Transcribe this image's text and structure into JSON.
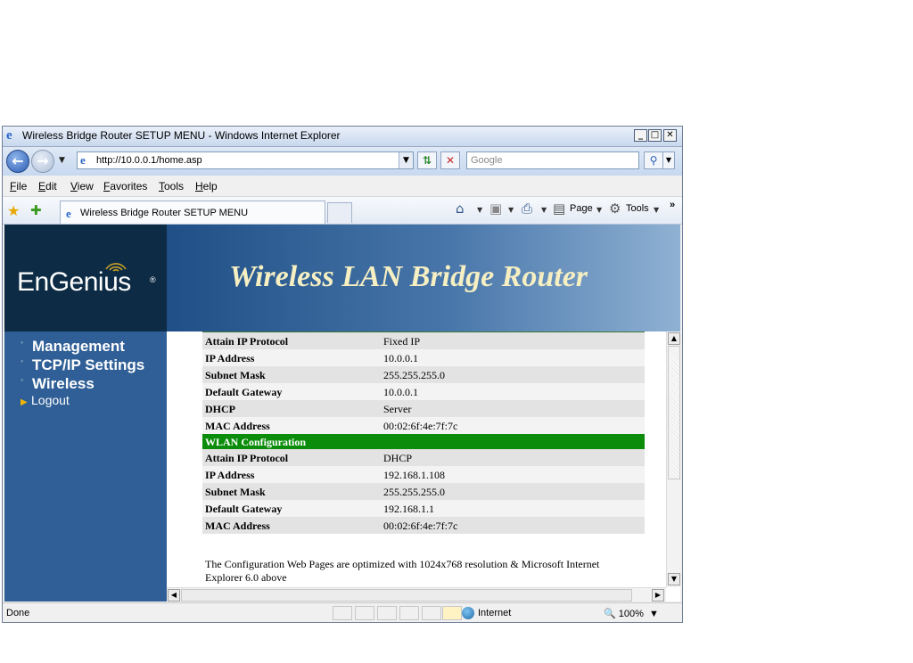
{
  "window": {
    "title": "Wireless Bridge Router SETUP MENU - Windows Internet Explorer",
    "minimize": "_",
    "maximize": "□",
    "close": "✕"
  },
  "address": {
    "url": "http://10.0.0.1/home.asp",
    "search_placeholder": "Google"
  },
  "menu": [
    "File",
    "Edit",
    "View",
    "Favorites",
    "Tools",
    "Help"
  ],
  "tab": {
    "label": "Wireless Bridge Router SETUP MENU"
  },
  "commands": {
    "page": "Page",
    "tools": "Tools"
  },
  "site": {
    "logo": "EnGenius",
    "logo_mark": "®",
    "banner_title": "Wireless LAN Bridge Router"
  },
  "sidebar": {
    "items": [
      "Management",
      "TCP/IP Settings",
      "Wireless"
    ],
    "logout": "Logout"
  },
  "lan": [
    {
      "key": "Attain IP Protocol",
      "value": "Fixed IP"
    },
    {
      "key": "IP Address",
      "value": "10.0.0.1"
    },
    {
      "key": "Subnet Mask",
      "value": "255.255.255.0"
    },
    {
      "key": "Default Gateway",
      "value": "10.0.0.1"
    },
    {
      "key": "DHCP",
      "value": "Server"
    },
    {
      "key": "MAC Address",
      "value": "00:02:6f:4e:7f:7c"
    }
  ],
  "wlan": {
    "heading": "WLAN Configuration",
    "rows": [
      {
        "key": "Attain IP Protocol",
        "value": "DHCP"
      },
      {
        "key": "IP Address",
        "value": "192.168.1.108"
      },
      {
        "key": "Subnet Mask",
        "value": "255.255.255.0"
      },
      {
        "key": "Default Gateway",
        "value": "192.168.1.1"
      },
      {
        "key": "MAC Address",
        "value": "00:02:6f:4e:7f:7c"
      }
    ]
  },
  "footnote": "The Configuration Web Pages are optimized with 1024x768 resolution & Microsoft Internet Explorer 6.0 above",
  "status": {
    "text": "Done",
    "zone": "Internet",
    "zoom": "100%"
  },
  "colors": {
    "section_green": "#0b8d0b",
    "sidebar_blue": "#2f5f96",
    "banner_text": "#f6efc2"
  }
}
